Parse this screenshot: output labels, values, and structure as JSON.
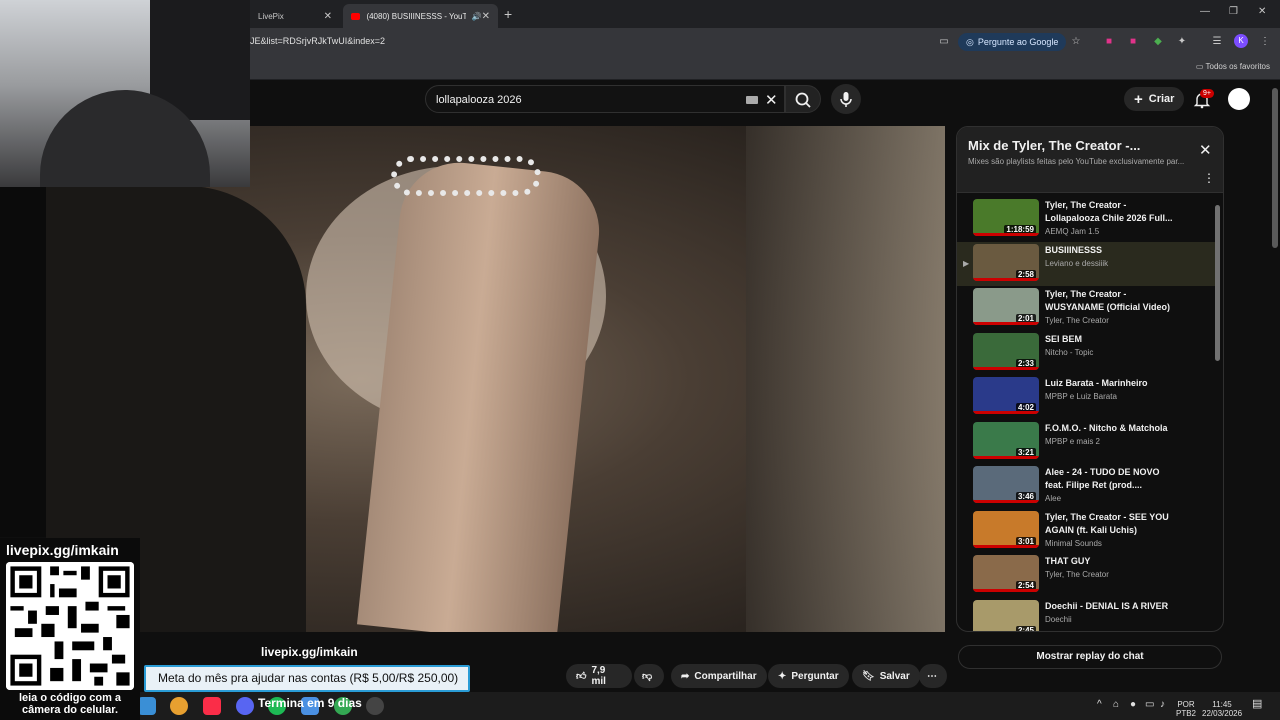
{
  "browser": {
    "tabs": [
      {
        "label": "LivePix"
      },
      {
        "label": "(4080) BUSIIINESSS - YouTu"
      }
    ],
    "url": "JE&list=RDSrjvRJkTwUI&index=2",
    "ask_google": "Pergunte ao Google",
    "bookmarks_label": "Todos os favoritos",
    "profile_initial": "K",
    "ext_badge": "12"
  },
  "youtube": {
    "search_value": "lollapalooza 2026",
    "create_label": "Criar",
    "notif_count": "9+",
    "actions": {
      "likes": "7,9 mil",
      "share": "Compartilhar",
      "ask": "Perguntar",
      "save": "Salvar"
    },
    "chat_button": "Mostrar replay do chat"
  },
  "playlist": {
    "title": "Mix de Tyler, The Creator -...",
    "subtitle": "Mixes são playlists feitas pelo YouTube exclusivamente par...",
    "items": [
      {
        "title": "Tyler, The Creator - Lollapalooza Chile 2026 Full...",
        "channel": "AEMQ Jam 1.5",
        "duration": "1:18:59",
        "color": "#4a7a2a"
      },
      {
        "title": "BUSIIINESSS",
        "channel": "Leviano e dessiiik",
        "duration": "2:58",
        "color": "#6a5a40",
        "active": true
      },
      {
        "title": "Tyler, The Creator - WUSYANAME (Official Video)",
        "channel": "Tyler, The Creator",
        "duration": "2:01",
        "color": "#8a9a8a"
      },
      {
        "title": "SEI BEM",
        "channel": "Nitcho - Topic",
        "duration": "2:33",
        "color": "#3a6a3a"
      },
      {
        "title": "Luiz Barata - Marinheiro",
        "channel": "MPBP e Luiz Barata",
        "duration": "4:02",
        "color": "#2a3a8a"
      },
      {
        "title": "F.O.M.O. - Nitcho & Matchola",
        "channel": "MPBP e mais 2",
        "duration": "3:21",
        "color": "#3a7a4a"
      },
      {
        "title": "Alee - 24 - TUDO DE NOVO feat. Filipe Ret (prod....",
        "channel": "Alee",
        "duration": "3:46",
        "color": "#5a6a7a"
      },
      {
        "title": "Tyler, The Creator - SEE YOU AGAIN (ft. Kali Uchis)",
        "channel": "Minimal Sounds",
        "duration": "3:01",
        "color": "#c87a2a"
      },
      {
        "title": "THAT GUY",
        "channel": "Tyler, The Creator",
        "duration": "2:54",
        "color": "#8a6a4a"
      },
      {
        "title": "Doechii - DENIAL IS A RIVER",
        "channel": "Doechii",
        "duration": "2:45",
        "color": "#a89a6a"
      }
    ]
  },
  "stream_overlay": {
    "qr_label": "livepix.gg/imkain",
    "qr_caption_line1": "leia o código com a",
    "qr_caption_line2": "câmera do celular.",
    "link_text": "livepix.gg/imkain",
    "goal_text": "Meta do mês pra ajudar nas contas (R$ 5,00/R$ 250,00)",
    "ends_text": "Termina em 9 dias"
  },
  "taskbar": {
    "lang1": "POR",
    "lang2": "PTB2",
    "time": "11:45",
    "date": "22/03/2026"
  },
  "colors": {
    "youtube_red": "#ff0000",
    "progress_red": "#cc0000",
    "goal_border": "#2a9cd6"
  }
}
